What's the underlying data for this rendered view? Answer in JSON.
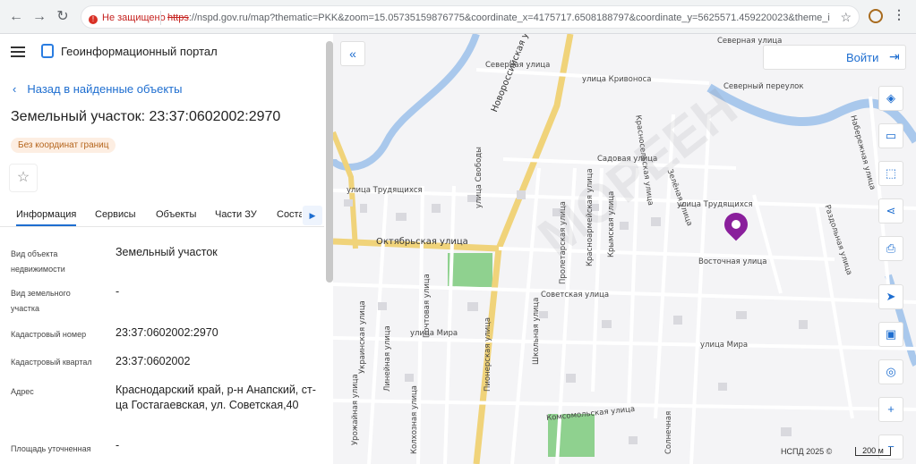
{
  "browser": {
    "security_label": "Не защищено",
    "url_scheme": "https",
    "url_rest": "://nspd.gov.ru/map?thematic=PKK&zoom=15.05735159876775&coordinate_x=4175717.6508188797&coordinate_y=5625571.459220023&theme_id=1&i..."
  },
  "header": {
    "title": "Геоинформационный портал"
  },
  "panel": {
    "back_label": "Назад в найденные объекты",
    "object_title": "Земельный участок: 23:37:0602002:2970",
    "badge": "Без координат границ",
    "tabs": [
      "Информация",
      "Сервисы",
      "Объекты",
      "Части ЗУ",
      "Соста"
    ],
    "rows": [
      {
        "label": "Вид объекта недвижимости",
        "value": "Земельный участок"
      },
      {
        "label": "Вид земельного участка",
        "value": "-"
      },
      {
        "label": "Кадастровый номер",
        "value": "23:37:0602002:2970"
      },
      {
        "label": "Кадастровый квартал",
        "value": "23:37:0602002"
      },
      {
        "label": "Адрес",
        "value": "Краснодарский край, р-н Анапский, ст-ца Гостагаевская, ул. Советская,40"
      },
      {
        "label": "Площадь уточненная",
        "value": "-"
      }
    ]
  },
  "map": {
    "login_label": "Войти",
    "attribution": "НСПД 2025 ©",
    "scale_label": "200 м",
    "watermark": "МОРЕЕН",
    "labels": {
      "oktyabrskaya": "Октябрьская улица",
      "novorossiyskaya": "Новороссийская улица",
      "severnaya_top": "Северная улица",
      "severnaya": "Северная улица",
      "krivonosa": "улица Кривоноса",
      "severny_per": "Северный переулок",
      "sadovaya": "Садовая улица",
      "trudyashchikhsya_l": "улица Трудящихся",
      "trudyashchikhsya_r": "улица Трудящихся",
      "vostochnaya": "Восточная улица",
      "sovetskaya": "Советская улица",
      "mira_l": "улица Мира",
      "mira_r": "улица Мира",
      "komsomolskaya": "Комсомольская улица",
      "pionerskaya": "Пионерская улица",
      "shkolnaya": "Школьная улица",
      "proletarskaya": "Пролетарская улица",
      "krasnoarmeyskaya": "Красноармейская улица",
      "krymskaya": "Крымская улица",
      "ukrainskaya": "Украинская улица",
      "pochtovaya": "Почтовая улица",
      "lineynaya": "Линейная улица",
      "urozhaynaya": "Урожайная улица",
      "kolkhoznaya": "Колхозная улица",
      "zelenaya": "Зелёная улица",
      "razdolnaya": "Раздольная улица",
      "naberezhnaya": "Набережная улица",
      "krasnoselskaya": "Красносельская улица",
      "solnechnaya": "Солнечная",
      "svobody": "улица Свободы"
    }
  }
}
